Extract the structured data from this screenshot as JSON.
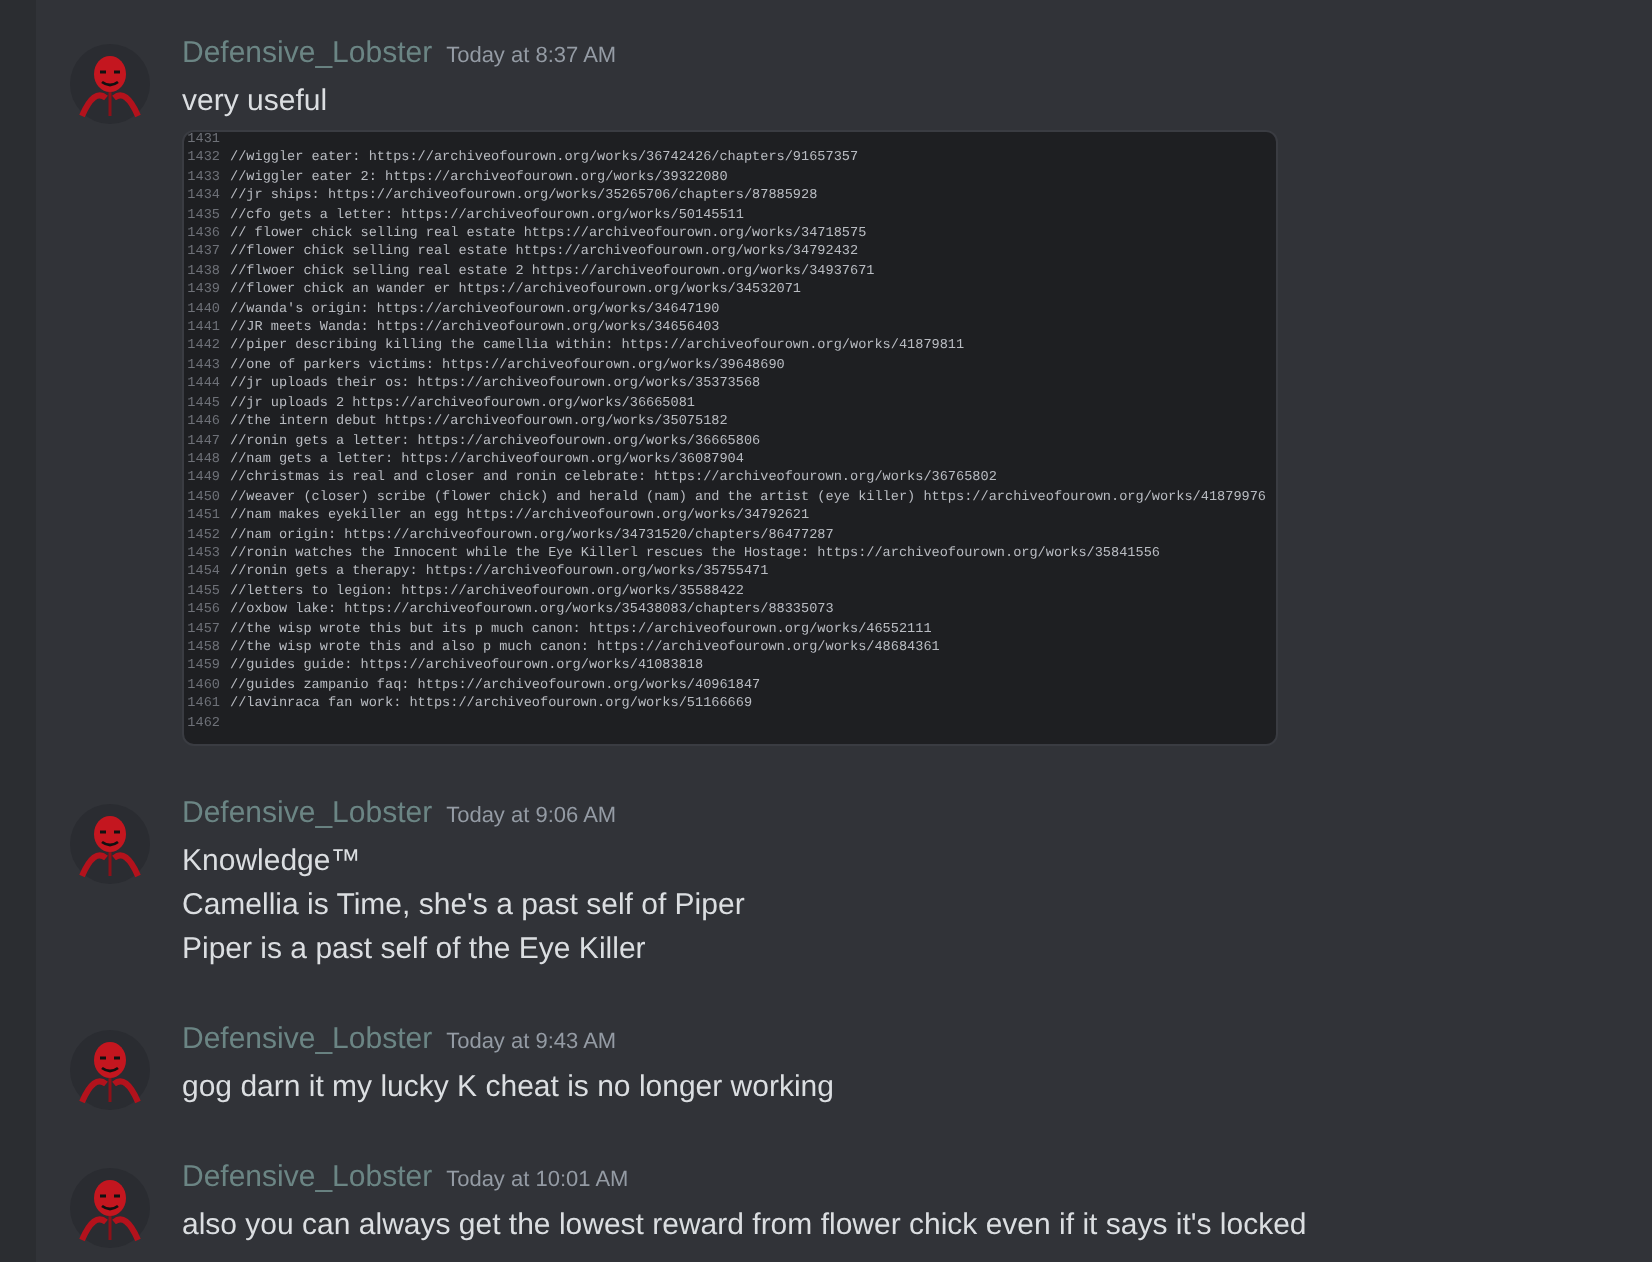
{
  "messages": [
    {
      "author": "Defensive_Lobster",
      "time": "Today at 8:37 AM",
      "lines": [
        "very useful"
      ],
      "attachment": {
        "lines": [
          {
            "number": "1431"
          },
          {
            "number": "1432",
            "text": "//wiggler eater: https://archiveofourown.org/works/36742426/chapters/91657357"
          },
          {
            "number": "1433",
            "text": "//wiggler eater 2: https://archiveofourown.org/works/39322080"
          },
          {
            "number": "1434",
            "text": "//jr ships: https://archiveofourown.org/works/35265706/chapters/87885928"
          },
          {
            "number": "1435",
            "text": "//cfo gets a letter: https://archiveofourown.org/works/50145511"
          },
          {
            "number": "1436",
            "text": "// flower chick selling real estate https://archiveofourown.org/works/34718575"
          },
          {
            "number": "1437",
            "text": "//flower chick selling real estate https://archiveofourown.org/works/34792432"
          },
          {
            "number": "1438",
            "text": "//flwoer chick selling real estate 2 https://archiveofourown.org/works/34937671"
          },
          {
            "number": "1439",
            "text": "//flower chick an wander er https://archiveofourown.org/works/34532071"
          },
          {
            "number": "1440",
            "text": "//wanda's origin: https://archiveofourown.org/works/34647190"
          },
          {
            "number": "1441",
            "text": "//JR meets Wanda: https://archiveofourown.org/works/34656403"
          },
          {
            "number": "1442",
            "text": "//piper describing killing the camellia within: https://archiveofourown.org/works/41879811"
          },
          {
            "number": "1443",
            "text": "//one of parkers victims: https://archiveofourown.org/works/39648690"
          },
          {
            "number": "1444",
            "text": "//jr uploads their os: https://archiveofourown.org/works/35373568"
          },
          {
            "number": "1445",
            "text": "//jr uploads 2 https://archiveofourown.org/works/36665081"
          },
          {
            "number": "1446",
            "text": "//the intern debut https://archiveofourown.org/works/35075182"
          },
          {
            "number": "1447",
            "text": "//ronin gets a letter: https://archiveofourown.org/works/36665806"
          },
          {
            "number": "1448",
            "text": "//nam gets a letter: https://archiveofourown.org/works/36087904"
          },
          {
            "number": "1449",
            "text": "//christmas is real and closer and ronin celebrate: https://archiveofourown.org/works/36765802"
          },
          {
            "number": "1450",
            "text": "//weaver (closer) scribe (flower chick) and herald (nam) and the artist (eye killer) https://archiveofourown.org/works/41879976"
          },
          {
            "number": "1451",
            "text": "//nam makes eyekiller an egg https://archiveofourown.org/works/34792621"
          },
          {
            "number": "1452",
            "text": "//nam origin: https://archiveofourown.org/works/34731520/chapters/86477287"
          },
          {
            "number": "1453",
            "text": "//ronin watches the Innocent while the Eye Killerl rescues the Hostage: https://archiveofourown.org/works/35841556"
          },
          {
            "number": "1454",
            "text": "//ronin gets a therapy: https://archiveofourown.org/works/35755471"
          },
          {
            "number": "1455",
            "text": "//letters to legion: https://archiveofourown.org/works/35588422"
          },
          {
            "number": "1456",
            "text": "//oxbow lake: https://archiveofourown.org/works/35438083/chapters/88335073"
          },
          {
            "number": "1457",
            "text": "//the wisp wrote this but its p much canon: https://archiveofourown.org/works/46552111"
          },
          {
            "number": "1458",
            "text": "//the wisp wrote this and also p much canon: https://archiveofourown.org/works/48684361"
          },
          {
            "number": "1459",
            "text": "//guides guide: https://archiveofourown.org/works/41083818"
          },
          {
            "number": "1460",
            "text": "//guides zampanio faq: https://archiveofourown.org/works/40961847"
          },
          {
            "number": "1461",
            "text": "//lavinraca fan work: https://archiveofourown.org/works/51166669"
          },
          {
            "number": "1462"
          }
        ]
      }
    },
    {
      "author": "Defensive_Lobster",
      "time": "Today at 9:06 AM",
      "lines": [
        "Knowledge™",
        "Camellia is Time, she's a past self of Piper",
        "Piper is a past self of the Eye Killer"
      ]
    },
    {
      "author": "Defensive_Lobster",
      "time": "Today at 9:43 AM",
      "lines": [
        "gog darn it my lucky K cheat is no longer working"
      ]
    },
    {
      "author": "Defensive_Lobster",
      "time": "Today at 10:01 AM",
      "lines": [
        "also you can always get the lowest reward from flower chick even if it says it's locked"
      ]
    }
  ]
}
